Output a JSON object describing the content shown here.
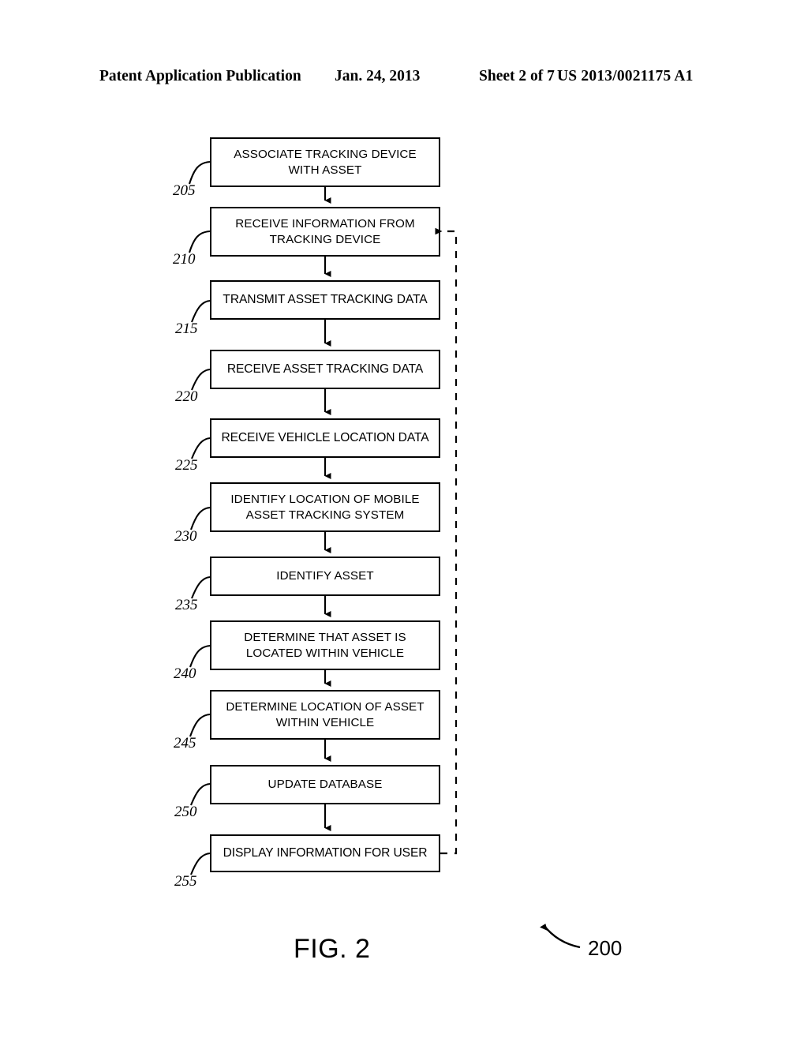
{
  "header": {
    "publication": "Patent Application Publication",
    "date": "Jan. 24, 2013",
    "sheet": "Sheet 2 of 7",
    "patent_number": "US 2013/0021175 A1"
  },
  "figure": {
    "caption": "FIG. 2",
    "overall_ref": "200"
  },
  "flowchart": {
    "steps": [
      {
        "ref": "205",
        "label": "ASSOCIATE TRACKING DEVICE WITH ASSET",
        "lines": [
          "ASSOCIATE TRACKING DEVICE",
          "WITH ASSET"
        ]
      },
      {
        "ref": "210",
        "label": "RECEIVE INFORMATION FROM TRACKING DEVICE",
        "lines": [
          "RECEIVE INFORMATION FROM",
          "TRACKING DEVICE"
        ]
      },
      {
        "ref": "215",
        "label": "TRANSMIT ASSET TRACKING DATA",
        "lines": [
          "TRANSMIT ASSET TRACKING DATA"
        ]
      },
      {
        "ref": "220",
        "label": "RECEIVE ASSET TRACKING DATA",
        "lines": [
          "RECEIVE ASSET TRACKING DATA"
        ]
      },
      {
        "ref": "225",
        "label": "RECEIVE VEHICLE LOCATION DATA",
        "lines": [
          "RECEIVE VEHICLE LOCATION DATA"
        ]
      },
      {
        "ref": "230",
        "label": "IDENTIFY LOCATION OF MOBILE ASSET TRACKING SYSTEM",
        "lines": [
          "IDENTIFY LOCATION OF MOBILE",
          "ASSET TRACKING SYSTEM"
        ]
      },
      {
        "ref": "235",
        "label": "IDENTIFY ASSET",
        "lines": [
          "IDENTIFY ASSET"
        ]
      },
      {
        "ref": "240",
        "label": "DETERMINE THAT ASSET IS LOCATED WITHIN VEHICLE",
        "lines": [
          "DETERMINE THAT ASSET IS",
          "LOCATED WITHIN VEHICLE"
        ]
      },
      {
        "ref": "245",
        "label": "DETERMINE LOCATION OF ASSET WITHIN VEHICLE",
        "lines": [
          "DETERMINE LOCATION OF ASSET",
          "WITHIN VEHICLE"
        ]
      },
      {
        "ref": "250",
        "label": "UPDATE DATABASE",
        "lines": [
          "UPDATE DATABASE"
        ]
      },
      {
        "ref": "255",
        "label": "DISPLAY INFORMATION FOR USER",
        "lines": [
          "DISPLAY INFORMATION FOR USER"
        ]
      }
    ],
    "feedback": {
      "from_step_ref": "255",
      "to_step_ref": "210",
      "style": "dashed"
    }
  },
  "colors": {
    "ink": "#000000",
    "paper": "#ffffff"
  }
}
